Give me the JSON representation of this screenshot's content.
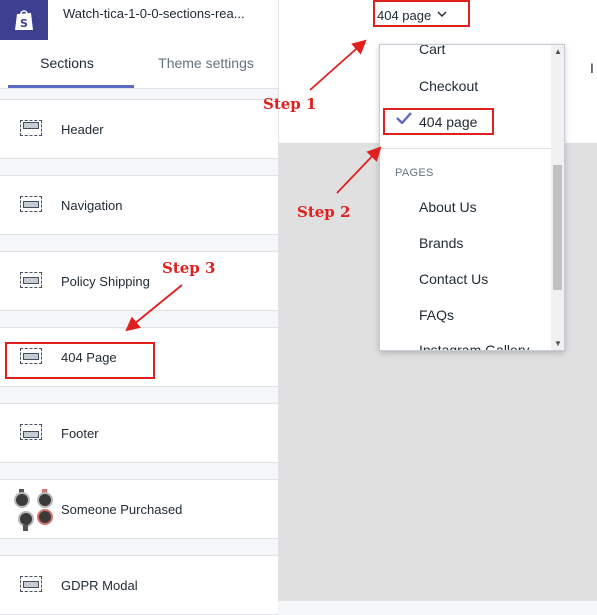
{
  "header": {
    "theme_name": "Watch-tica-1-0-0-sections-rea...",
    "page_selector": "404 page"
  },
  "sidebar": {
    "tabs": [
      {
        "label": "Sections"
      },
      {
        "label": "Theme settings"
      }
    ],
    "items": [
      {
        "label": "Header",
        "icon": "section-header-icon"
      },
      {
        "label": "Navigation",
        "icon": "section-icon"
      },
      {
        "label": "Policy Shipping",
        "icon": "section-icon"
      },
      {
        "label": "404 Page",
        "icon": "section-icon"
      },
      {
        "label": "Footer",
        "icon": "section-footer-icon"
      },
      {
        "label": "Someone Purchased",
        "icon": "watches-thumbnail"
      },
      {
        "label": "GDPR Modal",
        "icon": "section-icon"
      }
    ]
  },
  "dropdown": {
    "items_top": [
      "Cart",
      "Checkout",
      "404 page"
    ],
    "selected": "404 page",
    "group_heading": "PAGES",
    "pages": [
      "About Us",
      "Brands",
      "Contact Us",
      "FAQs",
      "Instagram Gallery"
    ]
  },
  "preview": {
    "cut_text": "I"
  },
  "annotations": {
    "step1": "Step 1",
    "step2": "Step 2",
    "step3": "Step 3",
    "color": "#e0201f"
  },
  "colors": {
    "accent": "#5c6ac4",
    "logo_bg": "#3d3f8f"
  }
}
